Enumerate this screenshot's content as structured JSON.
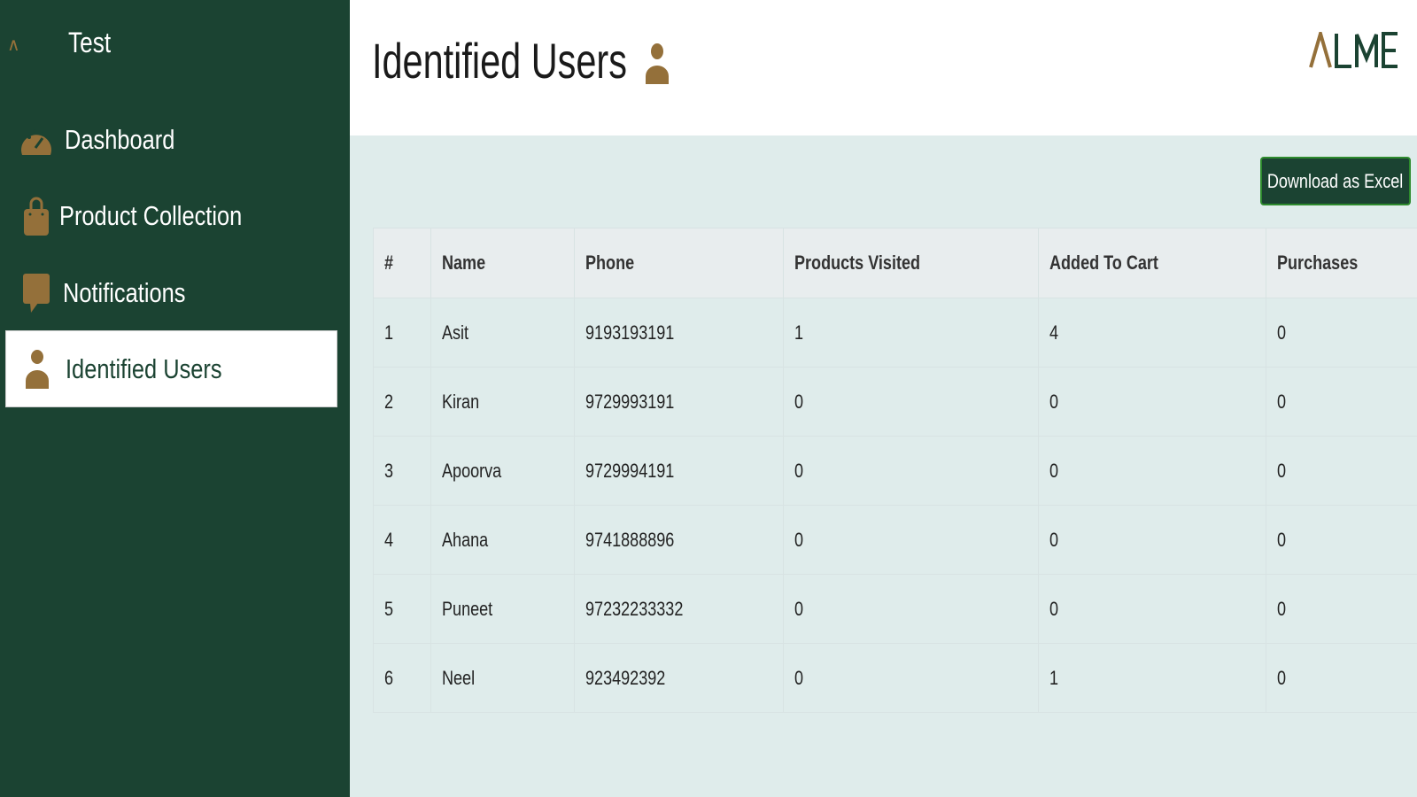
{
  "sidebar": {
    "brand": "Test",
    "items": [
      {
        "label": "Dashboard",
        "icon": "gauge-icon"
      },
      {
        "label": "Product Collection",
        "icon": "shopping-bag-icon"
      },
      {
        "label": "Notifications",
        "icon": "chat-bubble-icon"
      },
      {
        "label": "Identified Users",
        "icon": "user-icon",
        "active": true
      }
    ]
  },
  "header": {
    "title": "Identified Users",
    "logo": "ALME"
  },
  "toolbar": {
    "download_label": "Download as Excel"
  },
  "table": {
    "columns": [
      "#",
      "Name",
      "Phone",
      "Products Visited",
      "Added To Cart",
      "Purchases"
    ],
    "rows": [
      [
        "1",
        "Asit",
        "9193193191",
        "1",
        "4",
        "0"
      ],
      [
        "2",
        "Kiran",
        "9729993191",
        "0",
        "0",
        "0"
      ],
      [
        "3",
        "Apoorva",
        "9729994191",
        "0",
        "0",
        "0"
      ],
      [
        "4",
        "Ahana",
        "9741888896",
        "0",
        "0",
        "0"
      ],
      [
        "5",
        "Puneet",
        "97232233332",
        "0",
        "0",
        "0"
      ],
      [
        "6",
        "Neel",
        "923492392",
        "0",
        "1",
        "0"
      ]
    ]
  },
  "colors": {
    "sidebar": "#1b4332",
    "accent": "#94703a",
    "background": "#dfeceb"
  }
}
